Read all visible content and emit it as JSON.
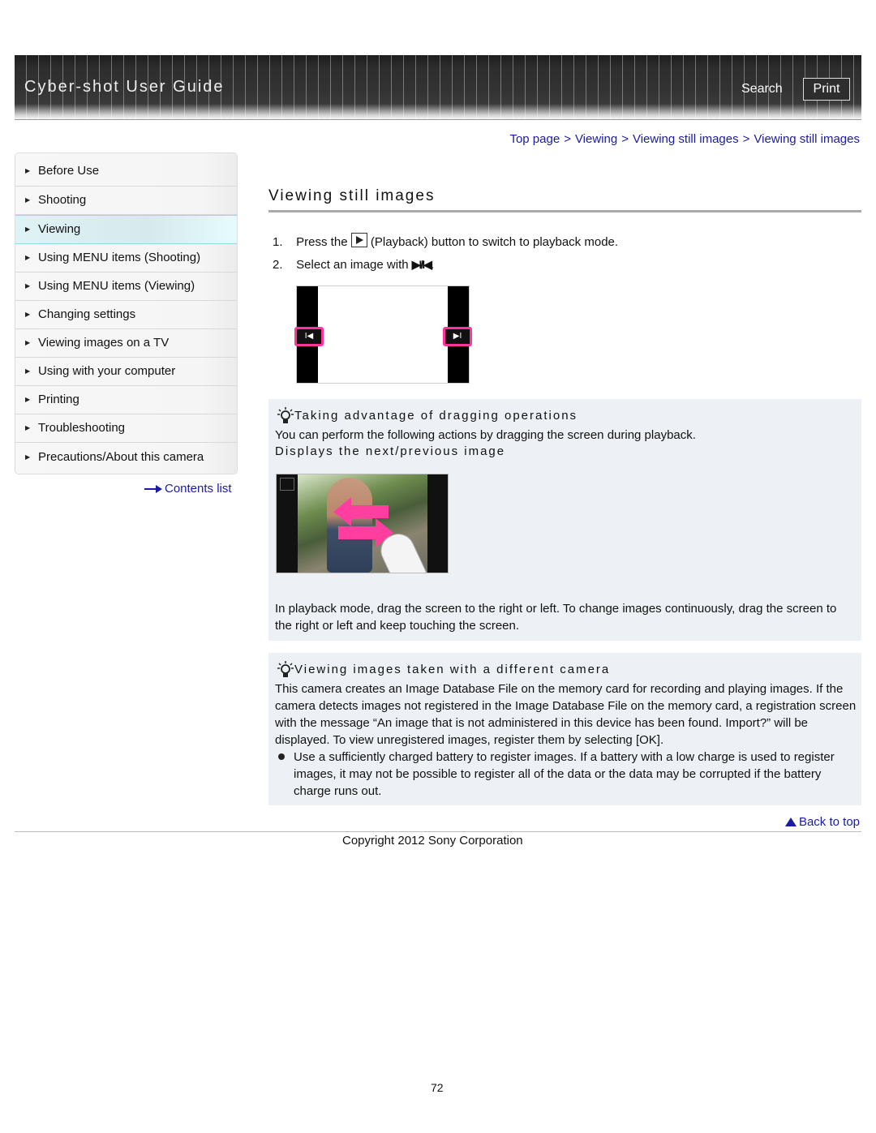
{
  "header": {
    "app_title": "Cyber-shot User Guide",
    "search_label": "Search",
    "print_label": "Print"
  },
  "breadcrumb": {
    "items": [
      "Top page",
      "Viewing",
      "Viewing still images",
      "Viewing still images"
    ],
    "separator": ">"
  },
  "sidebar": {
    "items": [
      {
        "label": "Before Use",
        "active": false
      },
      {
        "label": "Shooting",
        "active": false
      },
      {
        "label": "Viewing",
        "active": true
      },
      {
        "label": "Using MENU items (Shooting)",
        "active": false
      },
      {
        "label": "Using MENU items (Viewing)",
        "active": false
      },
      {
        "label": "Changing settings",
        "active": false
      },
      {
        "label": "Viewing images on a TV",
        "active": false
      },
      {
        "label": "Using with your computer",
        "active": false
      },
      {
        "label": "Printing",
        "active": false
      },
      {
        "label": "Troubleshooting",
        "active": false
      },
      {
        "label": "Precautions/About this camera",
        "active": false
      }
    ],
    "contents_link": "Contents list"
  },
  "main": {
    "title": "Viewing still images",
    "steps": [
      {
        "num": "1.",
        "before": "Press the",
        "icon": "playback-icon",
        "after": "(Playback) button to switch to playback mode."
      },
      {
        "num": "2.",
        "before": "Select an image with",
        "icon": "next-prev-icon",
        "glyph": "▶I/I◀",
        "after": "."
      }
    ],
    "screen_buttons": {
      "prev": "I◀",
      "next": "▶I"
    },
    "hint1": {
      "title": "Taking advantage of dragging operations",
      "intro": "You can perform the following actions by dragging the screen during playback.",
      "subhead": "Displays the next/previous image",
      "body": "In playback mode, drag the screen to the right or left. To change images continuously, drag the screen to the right or left and keep touching the screen."
    },
    "hint2": {
      "title": "Viewing images taken with a different camera",
      "body": "This camera creates an Image Database File on the memory card for recording and playing images. If the camera detects images not registered in the Image Database File on the memory card, a registration screen with the message “An image that is not administered in this device has been found. Import?” will be displayed. To view unregistered images, register them by selecting [OK].",
      "bullet": "Use a sufficiently charged battery to register images. If a battery with a low charge is used to register images, it may not be possible to register all of the data or the data may be corrupted if the battery charge runs out."
    }
  },
  "footer": {
    "back_to_top": "Back to top",
    "copyright": "Copyright 2012 Sony Corporation",
    "page_number": "72"
  },
  "colors": {
    "link": "#1a1aa6",
    "highlight": "#ff3399",
    "hint_bg": "#edf0f4",
    "active_item": "#d6eaee"
  }
}
